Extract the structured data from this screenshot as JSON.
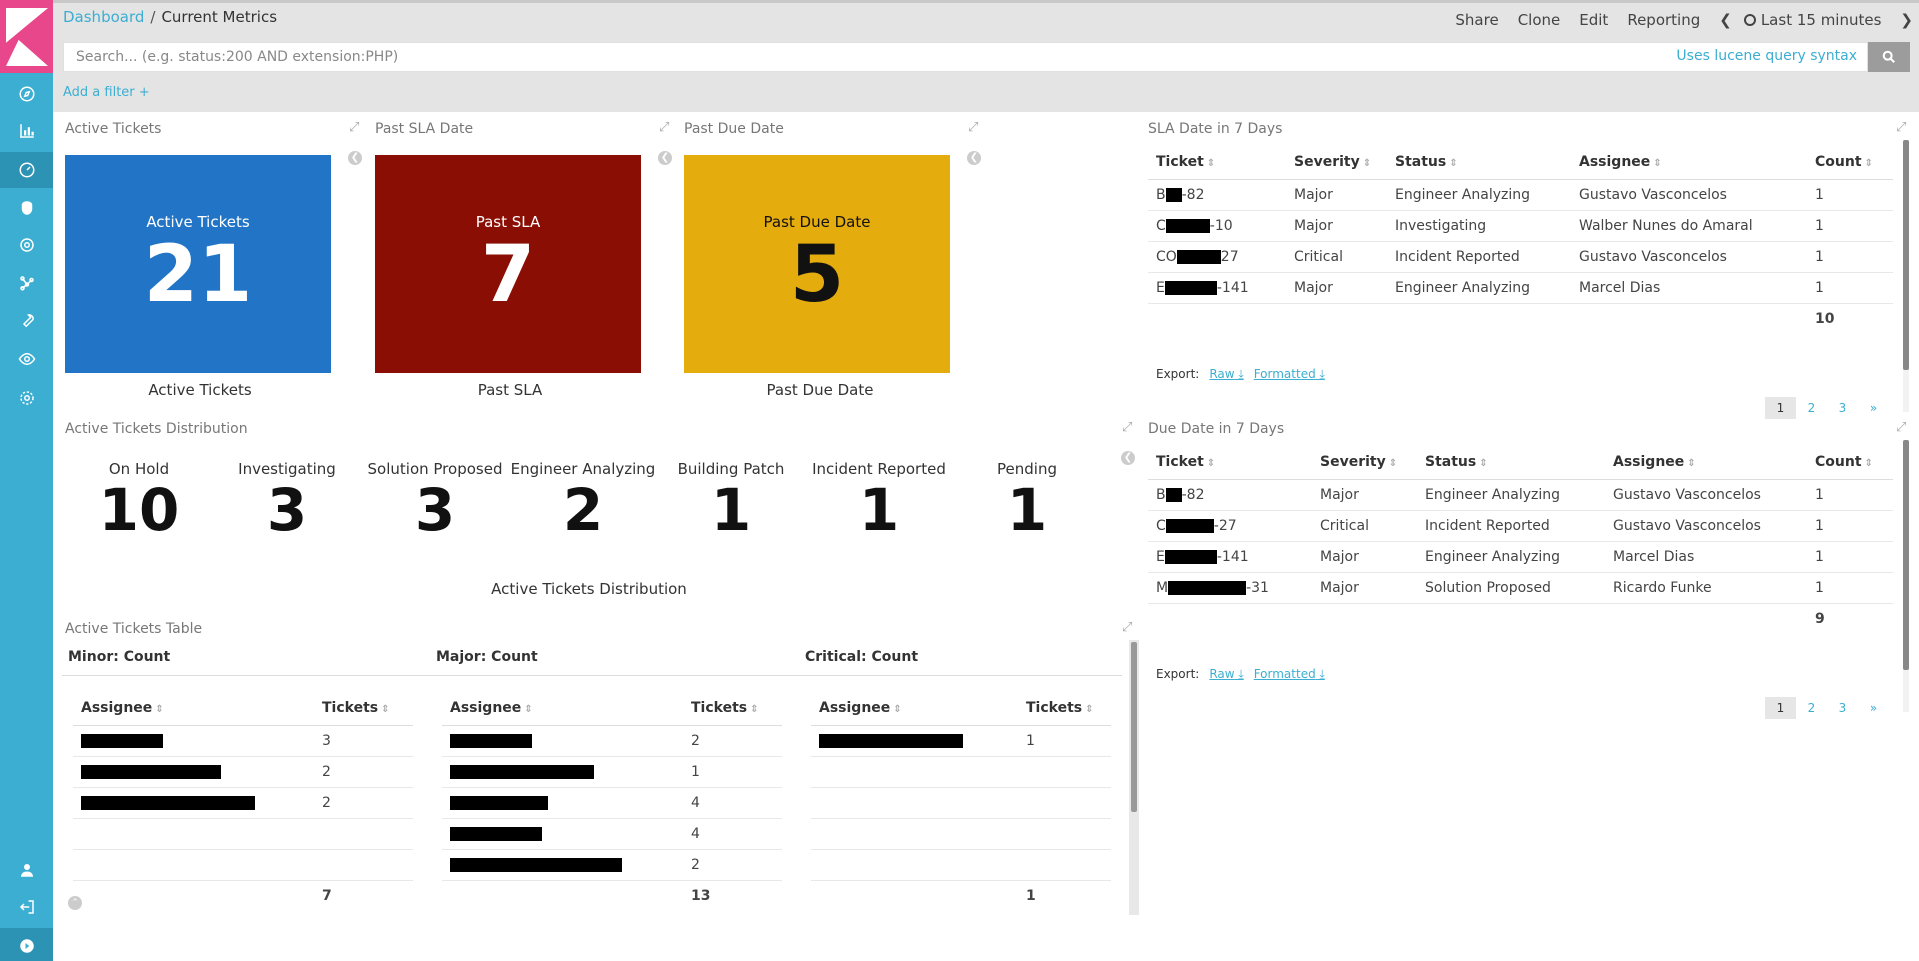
{
  "breadcrumb": {
    "root": "Dashboard",
    "separator": "/",
    "current": "Current Metrics"
  },
  "top_actions": {
    "share": "Share",
    "clone": "Clone",
    "edit": "Edit",
    "reporting": "Reporting",
    "time_range": "Last 15 minutes"
  },
  "search": {
    "placeholder": "Search... (e.g. status:200 AND extension:PHP)",
    "lucene_link": "Uses lucene query syntax"
  },
  "filter": {
    "add_filter": "Add a filter +"
  },
  "panels": {
    "active_tickets": {
      "title": "Active Tickets",
      "label": "Active Tickets",
      "value": "21",
      "caption": "Active Tickets",
      "color": "#2275c6"
    },
    "past_sla": {
      "title": "Past SLA Date",
      "label": "Past SLA",
      "value": "7",
      "caption": "Past SLA",
      "color": "#8b0e04"
    },
    "past_due": {
      "title": "Past Due Date",
      "label": "Past Due Date",
      "value": "5",
      "caption": "Past Due Date",
      "color": "#e5ac0e"
    },
    "distribution": {
      "title": "Active Tickets Distribution",
      "caption": "Active Tickets Distribution",
      "items": [
        {
          "label": "On Hold",
          "value": "10"
        },
        {
          "label": "Investigating",
          "value": "3"
        },
        {
          "label": "Solution Proposed",
          "value": "3"
        },
        {
          "label": "Engineer Analyzing",
          "value": "2"
        },
        {
          "label": "Building Patch",
          "value": "1"
        },
        {
          "label": "Incident Reported",
          "value": "1"
        },
        {
          "label": "Pending",
          "value": "1"
        }
      ]
    },
    "sla7": {
      "title": "SLA Date in 7 Days",
      "headers": [
        "Ticket",
        "Severity",
        "Status",
        "Assignee",
        "Count"
      ],
      "rows": [
        {
          "ticket_prefix": "B",
          "ticket_suffix": "-82",
          "severity": "Major",
          "status": "Engineer Analyzing",
          "assignee": "Gustavo Vasconcelos",
          "count": "1"
        },
        {
          "ticket_prefix": "C",
          "ticket_suffix": "-10",
          "severity": "Major",
          "status": "Investigating",
          "assignee": "Walber Nunes do Amaral",
          "count": "1"
        },
        {
          "ticket_prefix": "CO",
          "ticket_suffix": "27",
          "severity": "Critical",
          "status": "Incident Reported",
          "assignee": "Gustavo Vasconcelos",
          "count": "1"
        },
        {
          "ticket_prefix": "E",
          "ticket_suffix": "-141",
          "severity": "Major",
          "status": "Engineer Analyzing",
          "assignee": "Marcel Dias",
          "count": "1"
        }
      ],
      "total": "10",
      "export_label": "Export:",
      "raw": "Raw",
      "formatted": "Formatted",
      "pages": [
        "1",
        "2",
        "3",
        "»"
      ]
    },
    "due7": {
      "title": "Due Date in 7 Days",
      "headers": [
        "Ticket",
        "Severity",
        "Status",
        "Assignee",
        "Count"
      ],
      "rows": [
        {
          "ticket_prefix": "B",
          "ticket_suffix": "-82",
          "severity": "Major",
          "status": "Engineer Analyzing",
          "assignee": "Gustavo Vasconcelos",
          "count": "1"
        },
        {
          "ticket_prefix": "C",
          "ticket_suffix": "-27",
          "severity": "Critical",
          "status": "Incident Reported",
          "assignee": "Gustavo Vasconcelos",
          "count": "1"
        },
        {
          "ticket_prefix": "E",
          "ticket_suffix": "-141",
          "severity": "Major",
          "status": "Engineer Analyzing",
          "assignee": "Marcel Dias",
          "count": "1"
        },
        {
          "ticket_prefix": "M",
          "ticket_suffix": "-31",
          "severity": "Major",
          "status": "Solution Proposed",
          "assignee": "Ricardo Funke",
          "count": "1"
        }
      ],
      "total": "9",
      "export_label": "Export:",
      "raw": "Raw",
      "formatted": "Formatted",
      "pages": [
        "1",
        "2",
        "3",
        "»"
      ]
    },
    "table": {
      "title": "Active Tickets Table",
      "groups": [
        {
          "header": "Minor: Count",
          "col_assignee": "Assignee",
          "col_tickets": "Tickets",
          "tickets": [
            "3",
            "2",
            "2"
          ],
          "total": "7"
        },
        {
          "header": "Major: Count",
          "col_assignee": "Assignee",
          "col_tickets": "Tickets",
          "tickets": [
            "2",
            "1",
            "4",
            "4",
            "2"
          ],
          "total": "13"
        },
        {
          "header": "Critical: Count",
          "col_assignee": "Assignee",
          "col_tickets": "Tickets",
          "tickets": [
            "1"
          ],
          "total": "1"
        }
      ]
    }
  }
}
